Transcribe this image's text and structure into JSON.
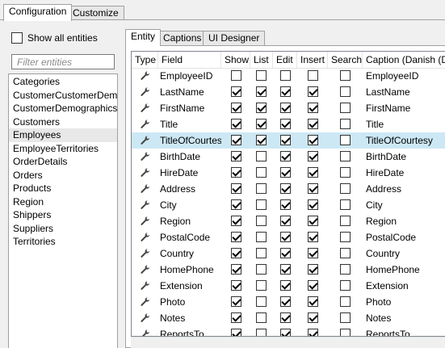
{
  "top_tabs": [
    {
      "label": "Configuration",
      "active": true
    },
    {
      "label": "Customize",
      "active": false
    }
  ],
  "left": {
    "show_all_label": "Show all entities",
    "show_all_checked": false,
    "filter_placeholder": "Filter entities",
    "filter_value": "",
    "entities": [
      "Categories",
      "CustomerCustomerDemo",
      "CustomerDemographics",
      "Customers",
      "Employees",
      "EmployeeTerritories",
      "OrderDetails",
      "Orders",
      "Products",
      "Region",
      "Shippers",
      "Suppliers",
      "Territories"
    ],
    "selected_entity": "Employees"
  },
  "sub_tabs": [
    {
      "label": "Entity",
      "active": true
    },
    {
      "label": "Captions",
      "active": false
    },
    {
      "label": "UI Designer",
      "active": false
    }
  ],
  "grid": {
    "columns": [
      "Type",
      "Field",
      "Show",
      "List",
      "Edit",
      "Insert",
      "Search",
      "Caption (Danish (De"
    ],
    "type_icon": "wrench-icon",
    "selected_field": "TitleOfCourtesy",
    "rows": [
      {
        "field": "EmployeeID",
        "show": false,
        "list": false,
        "edit": false,
        "insert": false,
        "search": false,
        "caption": "EmployeeID"
      },
      {
        "field": "LastName",
        "show": true,
        "list": true,
        "edit": true,
        "insert": true,
        "search": false,
        "caption": "LastName"
      },
      {
        "field": "FirstName",
        "show": true,
        "list": true,
        "edit": true,
        "insert": true,
        "search": false,
        "caption": "FirstName"
      },
      {
        "field": "Title",
        "show": true,
        "list": true,
        "edit": true,
        "insert": true,
        "search": false,
        "caption": "Title"
      },
      {
        "field": "TitleOfCourtesy",
        "show": true,
        "list": true,
        "edit": true,
        "insert": true,
        "search": false,
        "caption": "TitleOfCourtesy"
      },
      {
        "field": "BirthDate",
        "show": true,
        "list": false,
        "edit": true,
        "insert": true,
        "search": false,
        "caption": "BirthDate"
      },
      {
        "field": "HireDate",
        "show": true,
        "list": false,
        "edit": true,
        "insert": true,
        "search": false,
        "caption": "HireDate"
      },
      {
        "field": "Address",
        "show": true,
        "list": false,
        "edit": true,
        "insert": true,
        "search": false,
        "caption": "Address"
      },
      {
        "field": "City",
        "show": true,
        "list": false,
        "edit": true,
        "insert": true,
        "search": false,
        "caption": "City"
      },
      {
        "field": "Region",
        "show": true,
        "list": false,
        "edit": true,
        "insert": true,
        "search": false,
        "caption": "Region"
      },
      {
        "field": "PostalCode",
        "show": true,
        "list": false,
        "edit": true,
        "insert": true,
        "search": false,
        "caption": "PostalCode"
      },
      {
        "field": "Country",
        "show": true,
        "list": false,
        "edit": true,
        "insert": true,
        "search": false,
        "caption": "Country"
      },
      {
        "field": "HomePhone",
        "show": true,
        "list": false,
        "edit": true,
        "insert": true,
        "search": false,
        "caption": "HomePhone"
      },
      {
        "field": "Extension",
        "show": true,
        "list": false,
        "edit": true,
        "insert": true,
        "search": false,
        "caption": "Extension"
      },
      {
        "field": "Photo",
        "show": true,
        "list": false,
        "edit": true,
        "insert": true,
        "search": false,
        "caption": "Photo"
      },
      {
        "field": "Notes",
        "show": true,
        "list": false,
        "edit": true,
        "insert": true,
        "search": false,
        "caption": "Notes"
      },
      {
        "field": "ReportsTo",
        "show": true,
        "list": false,
        "edit": true,
        "insert": true,
        "search": false,
        "caption": "ReportsTo"
      }
    ]
  },
  "colors": {
    "selection": "#cce8f4",
    "panel_bg": "#f0f0f0"
  }
}
